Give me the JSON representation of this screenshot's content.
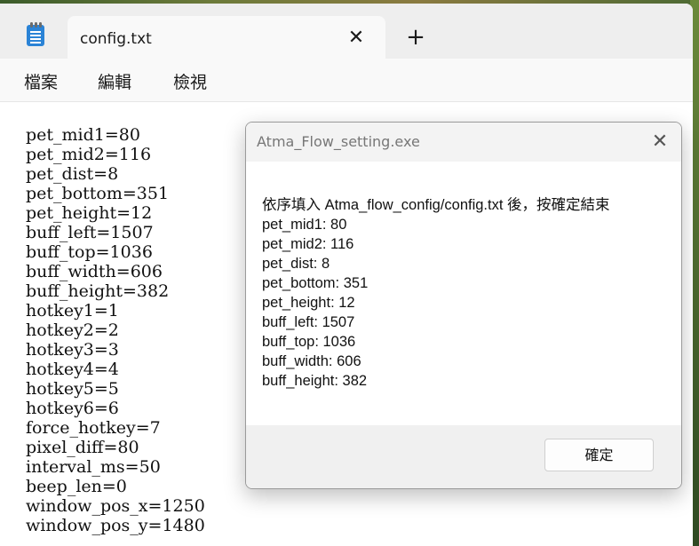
{
  "notepad": {
    "tab_title": "config.txt",
    "tab_close_glyph": "✕",
    "new_tab_glyph": "+",
    "app_icon": "notepad-icon",
    "menu": [
      "檔案",
      "編輯",
      "檢視"
    ],
    "lines": [
      "pet_mid1=80",
      "pet_mid2=116",
      "pet_dist=8",
      "pet_bottom=351",
      "pet_height=12",
      "buff_left=1507",
      "buff_top=1036",
      "buff_width=606",
      "buff_height=382",
      "hotkey1=1",
      "hotkey2=2",
      "hotkey3=3",
      "hotkey4=4",
      "hotkey5=5",
      "hotkey6=6",
      "force_hotkey=7",
      "pixel_diff=80",
      "interval_ms=50",
      "beep_len=0",
      "window_pos_x=1250",
      "window_pos_y=1480"
    ]
  },
  "dialog": {
    "title": "Atma_Flow_setting.exe",
    "close_glyph": "✕",
    "message_lines": [
      "依序填入 Atma_flow_config/config.txt 後，按確定結束",
      "pet_mid1: 80",
      "pet_mid2: 116",
      "pet_dist: 8",
      "pet_bottom: 351",
      "pet_height: 12",
      "buff_left: 1507",
      "buff_top: 1036",
      "buff_width: 606",
      "buff_height: 382"
    ],
    "ok_label": "確定"
  }
}
